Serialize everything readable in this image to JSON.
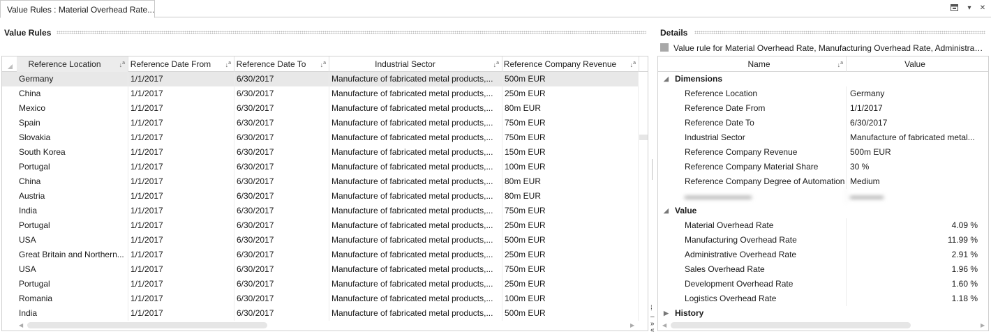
{
  "window": {
    "tab_title": "Value Rules : Material Overhead Rate..."
  },
  "value_rules": {
    "title": "Value Rules",
    "columns": [
      "Reference Location",
      "Reference Date From",
      "Reference Date To",
      "Industrial Sector",
      "Reference Company Revenue"
    ],
    "rows": [
      [
        "Germany",
        "1/1/2017",
        "6/30/2017",
        "Manufacture of fabricated metal products,...",
        "500m EUR"
      ],
      [
        "China",
        "1/1/2017",
        "6/30/2017",
        "Manufacture of fabricated metal products,...",
        "250m EUR"
      ],
      [
        "Mexico",
        "1/1/2017",
        "6/30/2017",
        "Manufacture of fabricated metal products,...",
        "80m EUR"
      ],
      [
        "Spain",
        "1/1/2017",
        "6/30/2017",
        "Manufacture of fabricated metal products,...",
        "750m EUR"
      ],
      [
        "Slovakia",
        "1/1/2017",
        "6/30/2017",
        "Manufacture of fabricated metal products,...",
        "750m EUR"
      ],
      [
        "South Korea",
        "1/1/2017",
        "6/30/2017",
        "Manufacture of fabricated metal products,...",
        "150m EUR"
      ],
      [
        "Portugal",
        "1/1/2017",
        "6/30/2017",
        "Manufacture of fabricated metal products,...",
        "100m EUR"
      ],
      [
        "China",
        "1/1/2017",
        "6/30/2017",
        "Manufacture of fabricated metal products,...",
        "80m EUR"
      ],
      [
        "Austria",
        "1/1/2017",
        "6/30/2017",
        "Manufacture of fabricated metal products,...",
        "80m EUR"
      ],
      [
        "India",
        "1/1/2017",
        "6/30/2017",
        "Manufacture of fabricated metal products,...",
        "750m EUR"
      ],
      [
        "Portugal",
        "1/1/2017",
        "6/30/2017",
        "Manufacture of fabricated metal products,...",
        "250m EUR"
      ],
      [
        "USA",
        "1/1/2017",
        "6/30/2017",
        "Manufacture of fabricated metal products,...",
        "500m EUR"
      ],
      [
        "Great Britain and Northern...",
        "1/1/2017",
        "6/30/2017",
        "Manufacture of fabricated metal products,...",
        "250m EUR"
      ],
      [
        "USA",
        "1/1/2017",
        "6/30/2017",
        "Manufacture of fabricated metal products,...",
        "750m EUR"
      ],
      [
        "Portugal",
        "1/1/2017",
        "6/30/2017",
        "Manufacture of fabricated metal products,...",
        "250m EUR"
      ],
      [
        "Romania",
        "1/1/2017",
        "6/30/2017",
        "Manufacture of fabricated metal products,...",
        "100m EUR"
      ],
      [
        "India",
        "1/1/2017",
        "6/30/2017",
        "Manufacture of fabricated metal products,...",
        "500m EUR"
      ]
    ]
  },
  "details": {
    "title": "Details",
    "caption": "Value rule for Material Overhead Rate, Manufacturing Overhead Rate, Administrati...",
    "columns": [
      "Name",
      "Value"
    ],
    "groups": {
      "dimensions": {
        "label": "Dimensions",
        "items": [
          {
            "name": "Reference Location",
            "value": "Germany"
          },
          {
            "name": "Reference Date From",
            "value": "1/1/2017"
          },
          {
            "name": "Reference Date To",
            "value": "6/30/2017"
          },
          {
            "name": "Industrial Sector",
            "value": "Manufacture of fabricated metal..."
          },
          {
            "name": "Reference Company Revenue",
            "value": "500m EUR"
          },
          {
            "name": "Reference Company Material Share",
            "value": "30 %"
          },
          {
            "name": "Reference Company Degree of Automation",
            "value": "Medium"
          }
        ]
      },
      "value": {
        "label": "Value",
        "items": [
          {
            "name": "Material Overhead Rate",
            "value": "4.09 %"
          },
          {
            "name": "Manufacturing Overhead Rate",
            "value": "11.99 %"
          },
          {
            "name": "Administrative Overhead Rate",
            "value": "2.91 %"
          },
          {
            "name": "Sales Overhead Rate",
            "value": "1.96 %"
          },
          {
            "name": "Development Overhead Rate",
            "value": "1.60 %"
          },
          {
            "name": "Logistics Overhead Rate",
            "value": "1.18 %"
          }
        ]
      },
      "history": {
        "label": "History"
      }
    }
  },
  "icons": {
    "tab_list": "window-list-icon",
    "dropdown": "chevron-down-icon",
    "close": "close-icon",
    "sort": "sort-icon",
    "expand": "expand-icon",
    "collapse": "collapse-icon"
  }
}
